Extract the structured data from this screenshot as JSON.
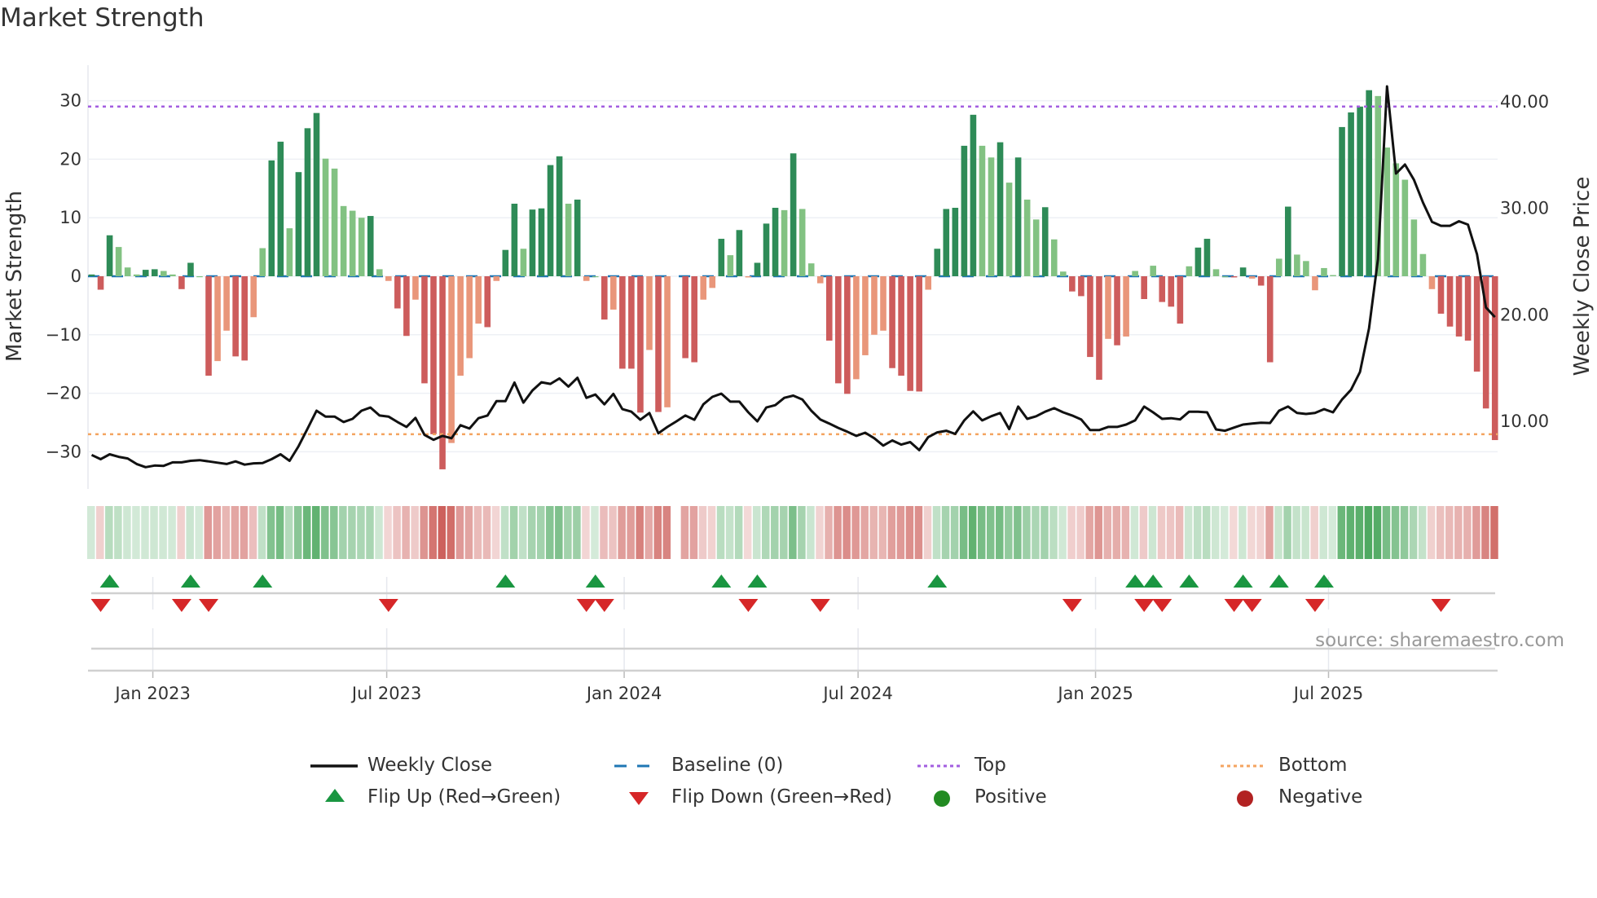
{
  "title": "Market Strength",
  "source": "source: sharemaestro.com",
  "legend": {
    "weekly_close": "Weekly Close",
    "baseline": "Baseline (0)",
    "top": "Top",
    "bottom": "Bottom",
    "flip_up": "Flip Up (Red→Green)",
    "flip_down": "Flip Down (Green→Red)",
    "positive": "Positive",
    "negative": "Negative"
  },
  "colors": {
    "strong_green": "#2e8b57",
    "weak_green": "#82c282",
    "strong_red": "#cd5c5c",
    "weak_red": "#e9967a",
    "line": "#111111",
    "baseline": "#1f77b4",
    "top": "#a35ee0",
    "bottom": "#f4a460",
    "flip_up": "#1a9641",
    "flip_down": "#d62728",
    "positive": "#228b22",
    "negative": "#b22222"
  },
  "chart_data": {
    "type": "bar+line",
    "title": "Market Strength",
    "left_axis": {
      "label": "Market Strength",
      "range": [
        -36.5,
        36
      ],
      "ticks": [
        "30",
        "20",
        "10",
        "0",
        "−10",
        "−20",
        "−30"
      ],
      "tick_values": [
        30,
        20,
        10,
        0,
        -10,
        -20,
        -30
      ]
    },
    "right_axis": {
      "label": "Weekly Close Price",
      "range": [
        3.66,
        43.4
      ],
      "ticks": [
        "40.00",
        "30.00",
        "20.00",
        "10.00"
      ],
      "tick_values": [
        40,
        30,
        20,
        10
      ]
    },
    "x_ticks": [
      {
        "label": "Jan 2023",
        "week": 6.8
      },
      {
        "label": "Jul 2023",
        "week": 32.8
      },
      {
        "label": "Jan 2024",
        "week": 59.2
      },
      {
        "label": "Jul 2024",
        "week": 85.2
      },
      {
        "label": "Jan 2025",
        "week": 111.6
      },
      {
        "label": "Jul 2025",
        "week": 137.5
      }
    ],
    "top_level": 29,
    "bottom_level": -27,
    "baseline": 0,
    "weeks_columns": [
      "market_strength",
      "weekly_close"
    ],
    "weeks": [
      [
        0.3,
        6.85
      ],
      [
        -2.3,
        6.45
      ],
      [
        7,
        6.91
      ],
      [
        5,
        6.67
      ],
      [
        1.5,
        6.52
      ],
      [
        0.3,
        6.0
      ],
      [
        1.1,
        5.7
      ],
      [
        1.2,
        5.85
      ],
      [
        0.9,
        5.82
      ],
      [
        0.3,
        6.15
      ],
      [
        -2.2,
        6.15
      ],
      [
        2.3,
        6.3
      ],
      [
        0,
        6.36
      ],
      [
        -17,
        6.24
      ],
      [
        -14.5,
        6.12
      ],
      [
        -9.3,
        6.0
      ],
      [
        -13.7,
        6.24
      ],
      [
        -14.4,
        5.94
      ],
      [
        -7,
        6.06
      ],
      [
        4.8,
        6.09
      ],
      [
        19.8,
        6.45
      ],
      [
        23,
        6.91
      ],
      [
        8.2,
        6.3
      ],
      [
        17.8,
        7.67
      ],
      [
        25.3,
        9.33
      ],
      [
        27.9,
        11.0
      ],
      [
        20.1,
        10.45
      ],
      [
        18.4,
        10.45
      ],
      [
        12,
        9.94
      ],
      [
        11.2,
        10.24
      ],
      [
        10,
        11.0
      ],
      [
        10.3,
        11.3
      ],
      [
        1.2,
        10.55
      ],
      [
        -0.8,
        10.45
      ],
      [
        -5.5,
        9.94
      ],
      [
        -10.2,
        9.48
      ],
      [
        -4,
        10.33
      ],
      [
        -18.3,
        8.73
      ],
      [
        -27,
        8.27
      ],
      [
        -33,
        8.64
      ],
      [
        -28.5,
        8.42
      ],
      [
        -17,
        9.64
      ],
      [
        -14,
        9.33
      ],
      [
        -8.1,
        10.3
      ],
      [
        -8.7,
        10.55
      ],
      [
        -0.8,
        11.9
      ],
      [
        4.5,
        11.9
      ],
      [
        12.4,
        13.64
      ],
      [
        4.7,
        11.76
      ],
      [
        11.4,
        12.91
      ],
      [
        11.6,
        13.67
      ],
      [
        19,
        13.52
      ],
      [
        20.5,
        14.03
      ],
      [
        12.4,
        13.27
      ],
      [
        13.1,
        14.09
      ],
      [
        -0.8,
        12.21
      ],
      [
        0,
        12.52
      ],
      [
        -7.4,
        11.6
      ],
      [
        -5.7,
        12.58
      ],
      [
        -15.8,
        11.15
      ],
      [
        -15.8,
        10.91
      ],
      [
        -23.3,
        10.15
      ],
      [
        -12.6,
        10.79
      ],
      [
        -23.2,
        8.88
      ],
      [
        -22.4,
        9.48
      ],
      [
        null,
        10.0
      ],
      [
        -14,
        10.55
      ],
      [
        -14.7,
        10.15
      ],
      [
        -4,
        11.6
      ],
      [
        -2,
        12.3
      ],
      [
        6.4,
        12.6
      ],
      [
        3.6,
        11.85
      ],
      [
        7.9,
        11.85
      ],
      [
        -0.2,
        10.85
      ],
      [
        2.3,
        10.0
      ],
      [
        9,
        11.3
      ],
      [
        11.7,
        11.52
      ],
      [
        11.3,
        12.21
      ],
      [
        21,
        12.42
      ],
      [
        11.5,
        12.06
      ],
      [
        2.2,
        11.0
      ],
      [
        -1.2,
        10.18
      ],
      [
        -11,
        9.79
      ],
      [
        -18.3,
        9.39
      ],
      [
        -20.1,
        9.03
      ],
      [
        -17.6,
        8.64
      ],
      [
        -13.5,
        8.94
      ],
      [
        -10,
        8.42
      ],
      [
        -9.3,
        7.73
      ],
      [
        -15.7,
        8.21
      ],
      [
        -17,
        7.82
      ],
      [
        -19.6,
        8.06
      ],
      [
        -19.7,
        7.3
      ],
      [
        -2.3,
        8.52
      ],
      [
        4.7,
        8.97
      ],
      [
        11.5,
        9.12
      ],
      [
        11.7,
        8.82
      ],
      [
        22.3,
        10.09
      ],
      [
        27.6,
        10.94
      ],
      [
        22.3,
        10.09
      ],
      [
        20.3,
        10.48
      ],
      [
        22.9,
        10.79
      ],
      [
        16,
        9.27
      ],
      [
        20.3,
        11.39
      ],
      [
        13.1,
        10.24
      ],
      [
        9.7,
        10.48
      ],
      [
        11.8,
        10.91
      ],
      [
        6.3,
        11.24
      ],
      [
        0.8,
        10.85
      ],
      [
        -2.6,
        10.55
      ],
      [
        -3.4,
        10.18
      ],
      [
        -13.8,
        9.18
      ],
      [
        -17.7,
        9.18
      ],
      [
        -10.7,
        9.48
      ],
      [
        -11.8,
        9.48
      ],
      [
        -10.3,
        9.7
      ],
      [
        0.9,
        10.09
      ],
      [
        -3.9,
        11.39
      ],
      [
        1.8,
        10.85
      ],
      [
        -4.4,
        10.24
      ],
      [
        -5.2,
        10.3
      ],
      [
        -8.1,
        10.18
      ],
      [
        1.7,
        10.91
      ],
      [
        4.9,
        10.91
      ],
      [
        6.4,
        10.85
      ],
      [
        1.2,
        9.24
      ],
      [
        0,
        9.12
      ],
      [
        -0.2,
        9.42
      ],
      [
        1.5,
        9.7
      ],
      [
        -0.4,
        9.79
      ],
      [
        -1.6,
        9.88
      ],
      [
        -14.7,
        9.85
      ],
      [
        3,
        11.0
      ],
      [
        11.9,
        11.39
      ],
      [
        3.7,
        10.79
      ],
      [
        2.6,
        10.7
      ],
      [
        -2.4,
        10.79
      ],
      [
        1.4,
        11.15
      ],
      [
        0.2,
        10.85
      ],
      [
        25.5,
        12.06
      ],
      [
        28,
        12.97
      ],
      [
        29,
        14.64
      ],
      [
        31.8,
        18.73
      ],
      [
        30.8,
        25.24
      ],
      [
        22,
        41.45
      ],
      [
        19.3,
        33.27
      ],
      [
        16.5,
        34.12
      ],
      [
        9.7,
        32.67
      ],
      [
        3.8,
        30.55
      ],
      [
        -2.2,
        28.73
      ],
      [
        -6.4,
        28.36
      ],
      [
        -8.6,
        28.36
      ],
      [
        -10.3,
        28.79
      ],
      [
        -11,
        28.48
      ],
      [
        -16.3,
        25.7
      ],
      [
        -22.6,
        20.7
      ],
      [
        -28,
        19.79
      ]
    ],
    "flip_up_weeks": [
      2,
      11,
      19,
      46,
      56,
      70,
      74,
      94,
      116,
      118,
      122,
      128,
      132,
      137
    ],
    "flip_down_weeks": [
      1,
      10,
      13,
      33,
      55,
      57,
      73,
      81,
      109,
      117,
      119,
      127,
      129,
      136,
      150
    ]
  }
}
